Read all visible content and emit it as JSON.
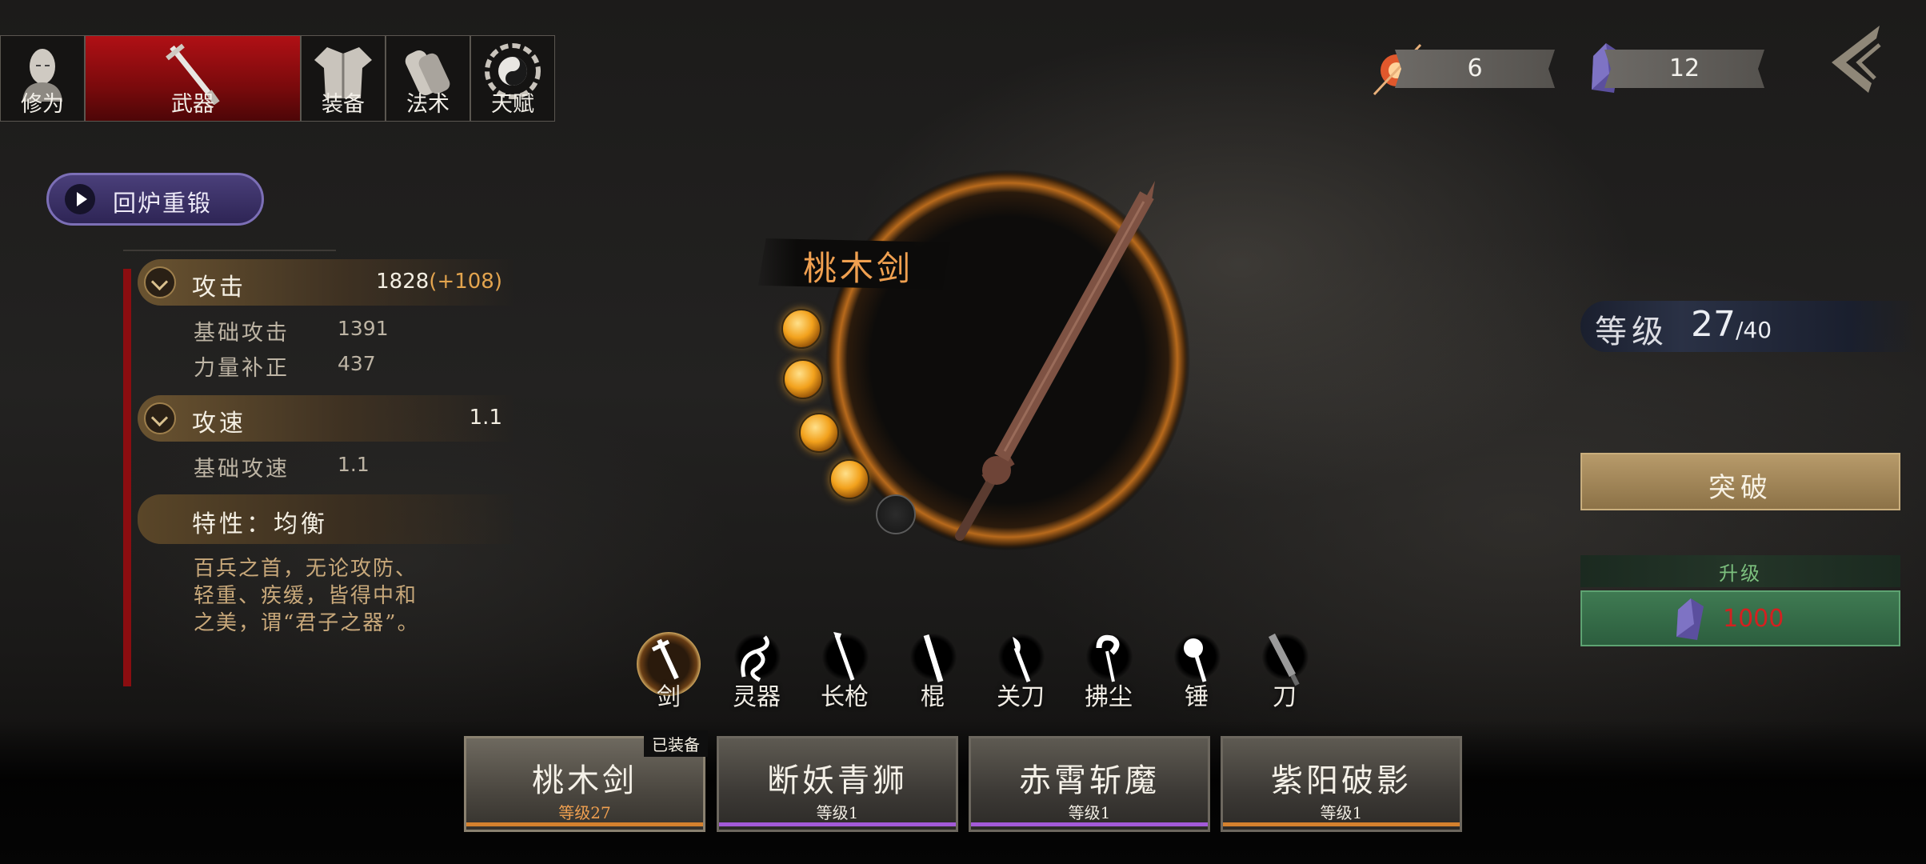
{
  "top_tabs": [
    {
      "label": "修为",
      "icon": "cultivator-head-icon",
      "active": false
    },
    {
      "label": "武器",
      "icon": "sword-icon",
      "active": true
    },
    {
      "label": "装备",
      "icon": "robe-icon",
      "active": false
    },
    {
      "label": "法术",
      "icon": "scroll-icon",
      "active": false
    },
    {
      "label": "天赋",
      "icon": "bagua-icon",
      "active": false
    }
  ],
  "currency": {
    "fire_orb": {
      "icon": "fire-orb-icon",
      "value": "6"
    },
    "crystal": {
      "icon": "purple-crystal-icon",
      "value": "12"
    }
  },
  "reforge_label": "回炉重锻",
  "stats": {
    "attack": {
      "label": "攻击",
      "value": "1828",
      "bonus": "(+108)",
      "subs": [
        {
          "label": "基础攻击",
          "value": "1391"
        },
        {
          "label": "力量补正",
          "value": "437"
        }
      ]
    },
    "speed": {
      "label": "攻速",
      "value": "1.1",
      "subs": [
        {
          "label": "基础攻速",
          "value": "1.1"
        }
      ]
    },
    "trait": {
      "label": "特性：均衡"
    },
    "description": "百兵之首，无论攻防、轻重、疾缓，皆得中和之美，谓“君子之器”。"
  },
  "weapon": {
    "name": "桃木剑",
    "filled_slots": 4,
    "total_slots": 5
  },
  "level": {
    "label": "等级",
    "current": "27",
    "max": "/40"
  },
  "breakthrough_label": "突破",
  "upgrade": {
    "label": "升级",
    "cost": "1000",
    "icon": "purple-crystal-icon"
  },
  "categories": [
    {
      "label": "剑",
      "icon": "sword-icon",
      "active": true
    },
    {
      "label": "灵器",
      "icon": "dragon-icon",
      "active": false
    },
    {
      "label": "长枪",
      "icon": "spear-icon",
      "active": false
    },
    {
      "label": "棍",
      "icon": "staff-icon",
      "active": false
    },
    {
      "label": "关刀",
      "icon": "guandao-icon",
      "active": false
    },
    {
      "label": "拂尘",
      "icon": "whisk-icon",
      "active": false
    },
    {
      "label": "锤",
      "icon": "hammer-icon",
      "active": false
    },
    {
      "label": "刀",
      "icon": "saber-icon",
      "active": false
    }
  ],
  "cards": [
    {
      "name": "桃木剑",
      "level": "等级27",
      "equipped_label": "已装备",
      "strip_color": "#d4812e",
      "level_color": "#f0a050"
    },
    {
      "name": "断妖青狮",
      "level": "等级1",
      "strip_color": "#a35ad8",
      "level_color": "#f0ece2"
    },
    {
      "name": "赤霄斩魔",
      "level": "等级1",
      "strip_color": "#a35ad8",
      "level_color": "#f0ece2"
    },
    {
      "name": "紫阳破影",
      "level": "等级1",
      "strip_color": "#d4812e",
      "level_color": "#f0ece2"
    }
  ]
}
